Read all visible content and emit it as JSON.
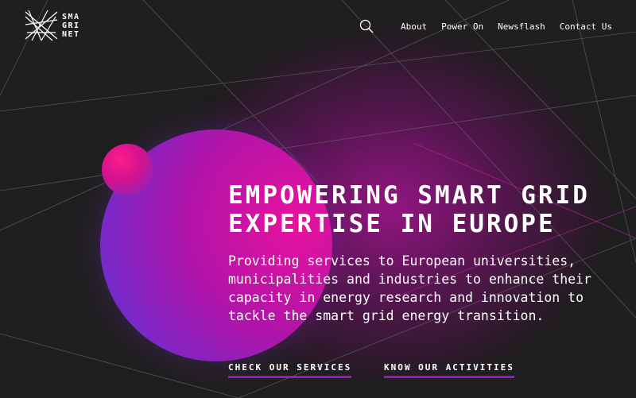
{
  "logo": {
    "lines": [
      "SMA",
      "GRI",
      "NET"
    ],
    "icon": "network-star-logo"
  },
  "nav": {
    "search_icon": "search-icon",
    "items": [
      "About",
      "Power On",
      "Newsflash",
      "Contact Us"
    ]
  },
  "hero": {
    "title_line1": "EMPOWERING SMART GRID",
    "title_line2": "EXPERTISE IN EUROPE",
    "text": "Providing services to European universities, municipalities and industries to enhance their capacity in energy research and innovation to tackle the smart grid energy transition.",
    "cta_primary": "CHECK OUR SERVICES",
    "cta_secondary": "KNOW OUR ACTIVITIES"
  },
  "colors": {
    "background": "#1f1f1f",
    "accent_magenta": "#e8129e",
    "accent_purple": "#7a28c8",
    "underline": "#9a16c0"
  }
}
